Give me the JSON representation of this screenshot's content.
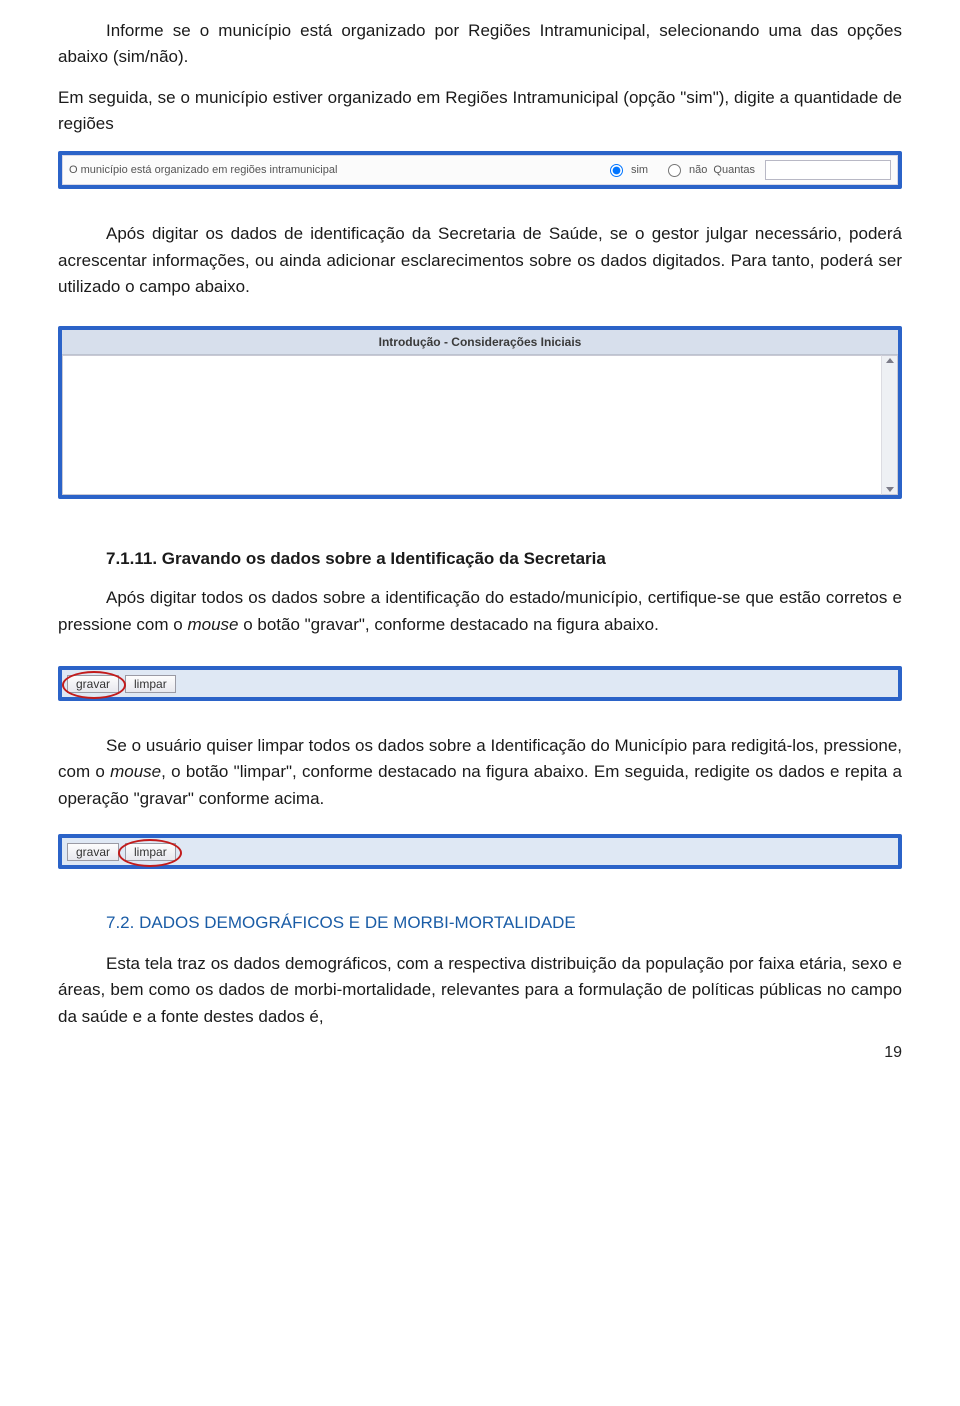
{
  "p1a": "Informe se o município está organizado por Regiões Intramunicipal, selecionando uma das opções abaixo (sim/não).",
  "p1b_pre": "Em seguida, se o município estiver organizado em Regiões Intramunicipal (opção ",
  "p1b_quote": "\"sim\"",
  "p1b_post": "), digite a quantidade de regiões",
  "radio": {
    "question": "O município está organizado em regiões intramunicipal",
    "opt_sim": "sim",
    "opt_nao": "não",
    "suffix": "Quantas"
  },
  "p2": "Após digitar os dados de identificação da Secretaria de Saúde, se o gestor julgar necessário, poderá acrescentar informações, ou ainda adicionar esclarecimentos sobre os dados digitados. Para tanto, poderá ser utilizado o campo abaixo.",
  "textarea_title": "Introdução - Considerações Iniciais",
  "h7111": "7.1.11. Gravando os dados sobre a Identificação da Secretaria",
  "p3_pre": "Após digitar todos os dados sobre a identificação do estado/município, certifique-se que estão corretos e pressione com o ",
  "p3_mouse": "mouse",
  "p3_post": " o botão \"gravar\", conforme destacado na figura abaixo.",
  "btn_gravar": "gravar",
  "btn_limpar": "limpar",
  "p4_pre": "Se o usuário quiser limpar todos os dados sobre a Identificação do Município para redigitá-los, pressione, com o ",
  "p4_mouse": "mouse",
  "p4_post": ", o botão \"limpar\", conforme destacado na figura abaixo. Em seguida, redigite os dados e repita a operação \"gravar\" conforme acima.",
  "h72": "7.2. DADOS DEMOGRÁFICOS E DE MORBI-MORTALIDADE",
  "p5": "Esta tela traz os dados demográficos, com a respectiva distribuição da população por faixa etária, sexo e áreas, bem como os dados de morbi-mortalidade, relevantes para a formulação de políticas públicas no campo da saúde e a fonte destes dados é,",
  "page_number": "19"
}
